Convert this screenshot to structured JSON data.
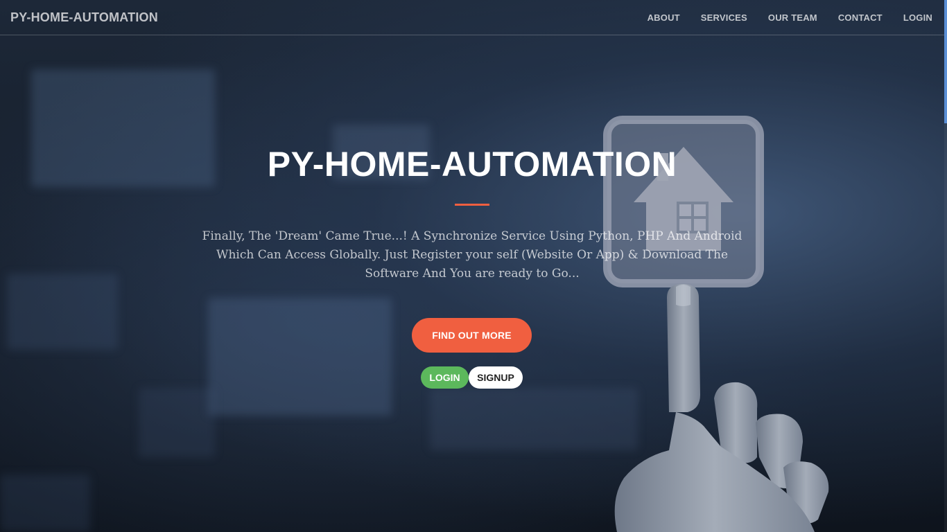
{
  "navbar": {
    "brand": "PY-HOME-AUTOMATION",
    "links": [
      {
        "label": "ABOUT"
      },
      {
        "label": "SERVICES"
      },
      {
        "label": "OUR TEAM"
      },
      {
        "label": "CONTACT"
      },
      {
        "label": "LOGIN"
      }
    ]
  },
  "hero": {
    "title": "PY-HOME-AUTOMATION",
    "description": "Finally, The 'Dream' Came True...! A Synchronize Service Using Python, PHP And Android Which Can Access Globally. Just Register your self (Website Or App) & Download The Software And You are ready to Go...",
    "find_out_more_label": "FIND OUT MORE",
    "login_label": "LOGIN",
    "signup_label": "SIGNUP"
  },
  "colors": {
    "accent": "#f05f40",
    "login_button": "#5cb85c",
    "signup_button": "#ffffff",
    "scrollbar_thumb": "#5a8fd6"
  },
  "icons": {
    "background_graphic": "house-icon",
    "hand_graphic": "pointing-finger"
  }
}
